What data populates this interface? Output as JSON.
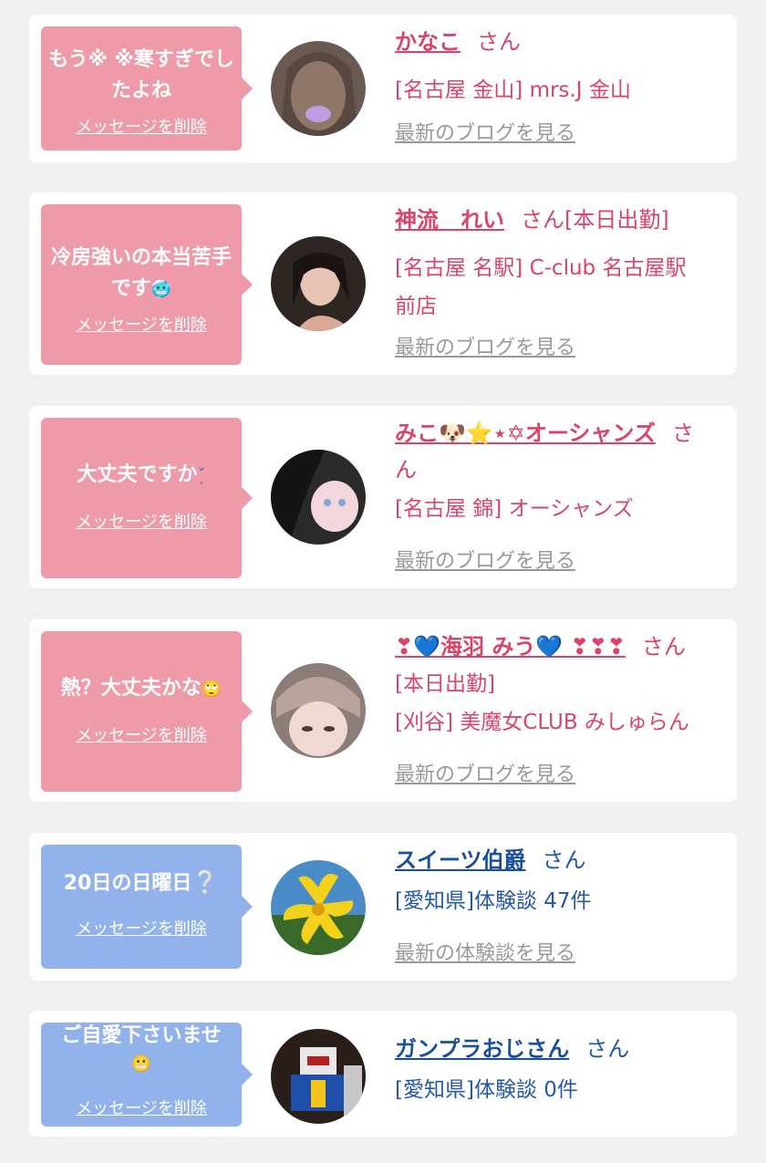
{
  "colors": {
    "pink_bubble": "#ee9aa8",
    "blue_bubble": "#92b2ec",
    "pink_text": "#d8446a",
    "blue_text": "#2457a5",
    "link_gray": "#999999",
    "background": "#f0f0f0"
  },
  "delete_label": "メッセージを削除",
  "cards": [
    {
      "message": "もう※ ※寒すぎでしたよね",
      "name": "かなこ",
      "suffix": "さん",
      "lines": [
        "[名古屋 金山] mrs.J 金山"
      ],
      "link": "最新のブログを見る"
    },
    {
      "message": "冷房強いの本当苦手です",
      "message_emoji": "🥶",
      "name": "神流　れい",
      "suffix": "さん[本日出勤]",
      "lines": [
        "[名古屋 名駅] C-club 名古屋駅",
        "前店"
      ],
      "link": "最新のブログを見る"
    },
    {
      "message": "大丈夫ですか",
      "message_emoji": "ˇ̣",
      "name": "みこ🐶⭐⋆✡オーシャンズ",
      "suffix": "さ",
      "suffix2": "ん",
      "lines": [
        "[名古屋 錦] オーシャンズ"
      ],
      "link": "最新のブログを見る"
    },
    {
      "message": "熱？大丈夫かな",
      "message_emoji": "🙄",
      "name": "❣💙海羽 みう💙 ❣❣❣",
      "suffix": "さん",
      "lines": [
        "[本日出勤]",
        "[刈谷] 美魔女CLUB みしゅらん"
      ],
      "link": "最新のブログを見る"
    },
    {
      "message": "20日の日曜日",
      "message_emoji": "❔",
      "name": "スイーツ伯爵",
      "suffix": "さん",
      "lines": [
        "[愛知県]体験談 47件"
      ],
      "link": "最新の体験談を見る"
    },
    {
      "message": "ご自愛下さいませ",
      "message_emoji": "😬",
      "name": "ガンプラおじさん",
      "suffix": "さん",
      "lines": [
        "[愛知県]体験談 0件"
      ]
    }
  ]
}
